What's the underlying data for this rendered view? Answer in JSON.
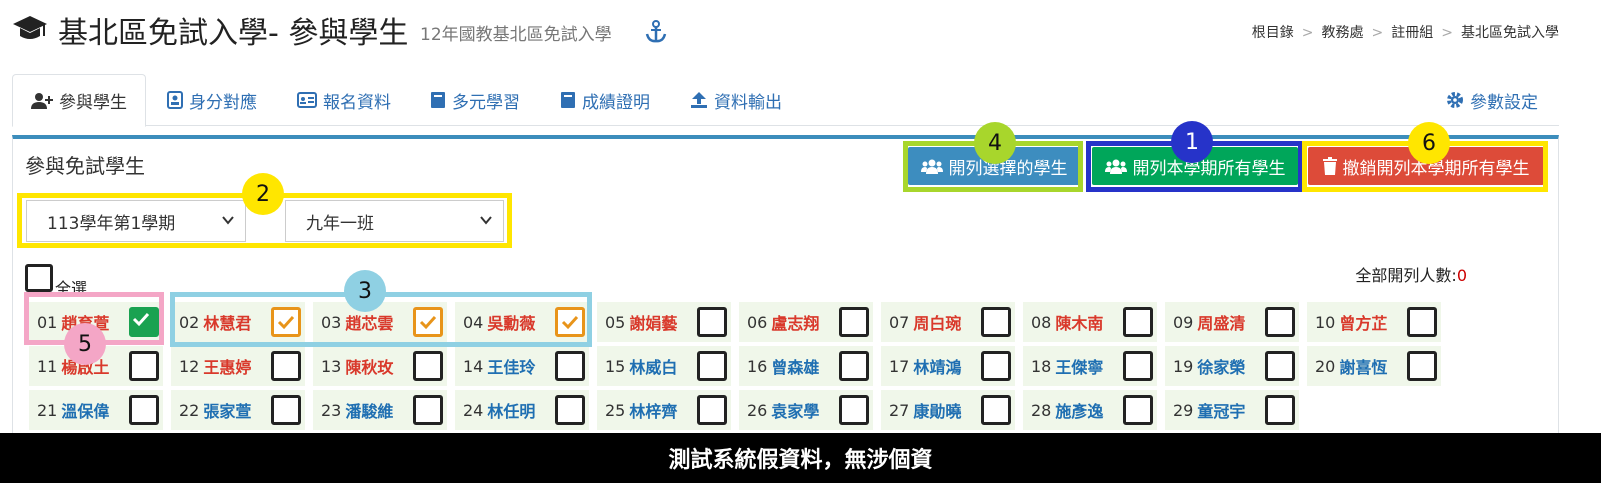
{
  "header": {
    "title": "基北區免試入學- 參與學生",
    "subtitle": "12年國教基北區免試入學",
    "breadcrumb": [
      "根目錄",
      "教務處",
      "註冊組",
      "基北區免試入學"
    ]
  },
  "tabs": [
    {
      "label": "參與學生",
      "icon": "user-plus-icon",
      "active": true
    },
    {
      "label": "身分對應",
      "icon": "id-badge-icon"
    },
    {
      "label": "報名資料",
      "icon": "id-card-icon"
    },
    {
      "label": "多元學習",
      "icon": "book-icon"
    },
    {
      "label": "成績證明",
      "icon": "book-icon"
    },
    {
      "label": "資料輸出",
      "icon": "upload-icon"
    },
    {
      "label": "參數設定",
      "icon": "gear-icon"
    }
  ],
  "panel": {
    "title": "參與免試學生",
    "buttons": {
      "list_selected": "開列選擇的學生",
      "list_all": "開列本學期所有學生",
      "revoke_all": "撤銷開列本學期所有學生"
    },
    "semester_select": "113學年第1學期",
    "class_select": "九年一班",
    "select_all_label": "全選",
    "total_label": "全部開列人數:",
    "total_value": "0"
  },
  "students": [
    {
      "no": "01",
      "name": "趙育萱",
      "gender": "f",
      "checked": "green"
    },
    {
      "no": "02",
      "name": "林慧君",
      "gender": "f",
      "checked": "on"
    },
    {
      "no": "03",
      "name": "趙芯雲",
      "gender": "f",
      "checked": "on"
    },
    {
      "no": "04",
      "name": "吳勳薇",
      "gender": "f",
      "checked": "on"
    },
    {
      "no": "05",
      "name": "謝娟藝",
      "gender": "f",
      "checked": "off"
    },
    {
      "no": "06",
      "name": "盧志翔",
      "gender": "f",
      "checked": "off"
    },
    {
      "no": "07",
      "name": "周白琬",
      "gender": "f",
      "checked": "off"
    },
    {
      "no": "08",
      "name": "陳木南",
      "gender": "f",
      "checked": "off"
    },
    {
      "no": "09",
      "name": "周盛清",
      "gender": "f",
      "checked": "off"
    },
    {
      "no": "10",
      "name": "曾方芷",
      "gender": "f",
      "checked": "off"
    },
    {
      "no": "11",
      "name": "楊啟土",
      "gender": "f",
      "checked": "off"
    },
    {
      "no": "12",
      "name": "王惠婷",
      "gender": "f",
      "checked": "off"
    },
    {
      "no": "13",
      "name": "陳秋玫",
      "gender": "f",
      "checked": "off"
    },
    {
      "no": "14",
      "name": "王佳玲",
      "gender": "m",
      "checked": "off"
    },
    {
      "no": "15",
      "name": "林威白",
      "gender": "m",
      "checked": "off"
    },
    {
      "no": "16",
      "name": "曾森雄",
      "gender": "m",
      "checked": "off"
    },
    {
      "no": "17",
      "name": "林靖鴻",
      "gender": "m",
      "checked": "off"
    },
    {
      "no": "18",
      "name": "王傑寧",
      "gender": "m",
      "checked": "off"
    },
    {
      "no": "19",
      "name": "徐家榮",
      "gender": "m",
      "checked": "off"
    },
    {
      "no": "20",
      "name": "謝喜恆",
      "gender": "m",
      "checked": "off"
    },
    {
      "no": "21",
      "name": "溫保偉",
      "gender": "m",
      "checked": "off"
    },
    {
      "no": "22",
      "name": "張家萱",
      "gender": "m",
      "checked": "off"
    },
    {
      "no": "23",
      "name": "潘駿維",
      "gender": "m",
      "checked": "off"
    },
    {
      "no": "24",
      "name": "林任明",
      "gender": "m",
      "checked": "off"
    },
    {
      "no": "25",
      "name": "林梓齊",
      "gender": "m",
      "checked": "off"
    },
    {
      "no": "26",
      "name": "袁家學",
      "gender": "m",
      "checked": "off"
    },
    {
      "no": "27",
      "name": "康勛曉",
      "gender": "m",
      "checked": "off"
    },
    {
      "no": "28",
      "name": "施彥逸",
      "gender": "m",
      "checked": "off"
    },
    {
      "no": "29",
      "name": "童冠宇",
      "gender": "m",
      "checked": "off"
    }
  ],
  "annotations": [
    "1",
    "2",
    "3",
    "4",
    "5",
    "6"
  ],
  "footer_note": "測試系統假資料，無涉個資",
  "colors": {
    "accent": "#3c8dbc",
    "green": "#00a65a",
    "red": "#dd4b39",
    "yellow": "#ffe600",
    "highlight_blue": "#2633c9",
    "highlight_cyan": "#8fd0e3",
    "highlight_pink": "#f4a6c6",
    "highlight_lime": "#a8d62c"
  }
}
